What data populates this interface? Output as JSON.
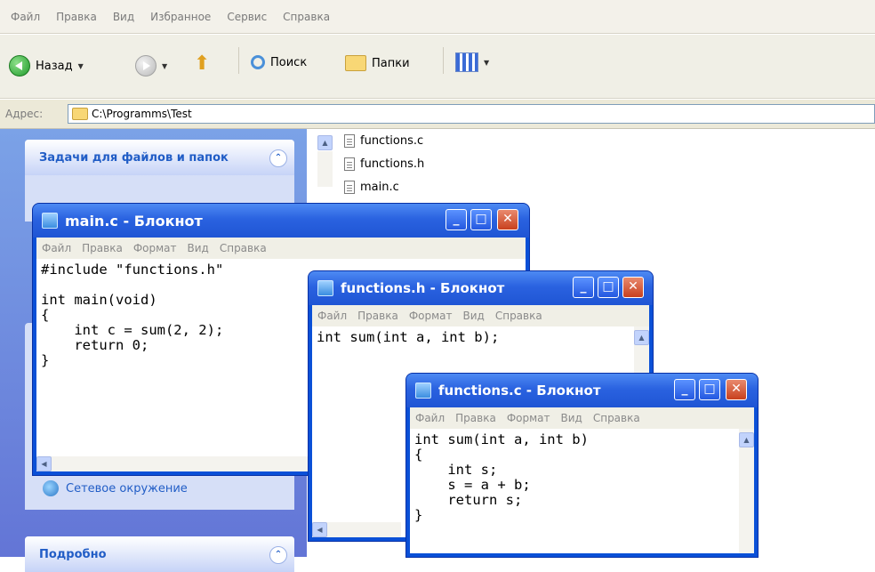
{
  "explorer": {
    "menu": [
      "Файл",
      "Правка",
      "Вид",
      "Избранное",
      "Сервис",
      "Справка"
    ],
    "toolbar": {
      "back_label": "Назад",
      "search_label": "Поиск",
      "folders_label": "Папки"
    },
    "address": {
      "label": "Адрес:",
      "value": "C:\\Programms\\Test"
    },
    "tasks_panel_title": "Задачи для файлов и папок",
    "details_panel_title": "Подробно",
    "network_label": "Сетевое окружение",
    "files": [
      "functions.c",
      "functions.h",
      "main.c"
    ]
  },
  "notepads": [
    {
      "title": "main.c - Блокнот",
      "menu": [
        "Файл",
        "Правка",
        "Формат",
        "Вид",
        "Справка"
      ],
      "content": "#include \"functions.h\"\n\nint main(void)\n{\n    int c = sum(2, 2);\n    return 0;\n}"
    },
    {
      "title": "functions.h - Блокнот",
      "menu": [
        "Файл",
        "Правка",
        "Формат",
        "Вид",
        "Справка"
      ],
      "content": "int sum(int a, int b);"
    },
    {
      "title": "functions.c - Блокнот",
      "menu": [
        "Файл",
        "Правка",
        "Формат",
        "Вид",
        "Справка"
      ],
      "content": "int sum(int a, int b)\n{\n    int s;\n    s = a + b;\n    return s;\n}"
    }
  ],
  "colors": {
    "xp_title_blue": "#2a62e0",
    "task_pane_blue": "#6375d6",
    "close_red": "#c8401e"
  }
}
